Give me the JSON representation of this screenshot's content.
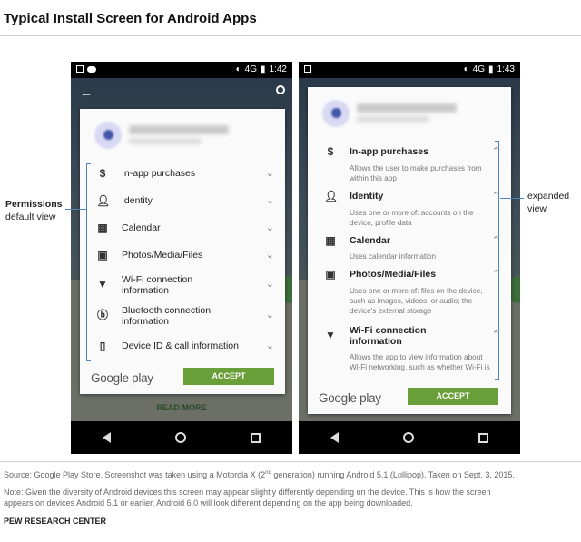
{
  "title": "Typical Install Screen for Android Apps",
  "annotations": {
    "left_bold": "Permissions",
    "left_sub": "default view",
    "right_line1": "expanded",
    "right_line2": "view"
  },
  "left_phone": {
    "status_time": "1:42",
    "network": "4G",
    "permissions": [
      {
        "icon": "dollar-icon",
        "label": "In-app purchases"
      },
      {
        "icon": "person-icon",
        "label": "Identity"
      },
      {
        "icon": "calendar-icon",
        "label": "Calendar"
      },
      {
        "icon": "photo-icon",
        "label": "Photos/Media/Files"
      },
      {
        "icon": "wifi-icon",
        "label": "Wi-Fi connection information"
      },
      {
        "icon": "bluetooth-icon",
        "label": "Bluetooth connection information"
      },
      {
        "icon": "device-icon",
        "label": "Device ID & call information"
      }
    ],
    "google_play": "Google play",
    "accept": "ACCEPT",
    "read_more": "READ MORE"
  },
  "right_phone": {
    "status_time": "1:43",
    "network": "4G",
    "permissions": [
      {
        "icon": "dollar-icon",
        "label": "In-app purchases",
        "description": "Allows the user to make purchases from within this app"
      },
      {
        "icon": "person-icon",
        "label": "Identity",
        "description": "Uses one or more of: accounts on the device, profile data"
      },
      {
        "icon": "calendar-icon",
        "label": "Calendar",
        "description": "Uses calendar information"
      },
      {
        "icon": "photo-icon",
        "label": "Photos/Media/Files",
        "description": "Uses one or more of: files on the device, such as images, videos, or audio; the device's external storage"
      },
      {
        "icon": "wifi-icon",
        "label": "Wi-Fi connection information",
        "description": "Allows the app to view information about Wi-Fi networking, such as whether Wi-Fi is enabled and names"
      }
    ],
    "google_play": "Google play",
    "accept": "ACCEPT"
  },
  "footer": {
    "source_a": "Source: Google Play Store. Screenshot was taken using a Motorola X (2",
    "source_sup": "nd",
    "source_b": " generation) running Android 5.1 (Lollipop). Taken on Sept. 3, 2015.",
    "note_line1": "Note: Given the diversity of Android devices this screen may appear slightly differently depending on the device. This is how the screen",
    "note_line2": "appears on devices Android 5.1 or earlier, Android 6.0 will look different depending on the app being downloaded.",
    "org": "PEW RESEARCH CENTER"
  }
}
